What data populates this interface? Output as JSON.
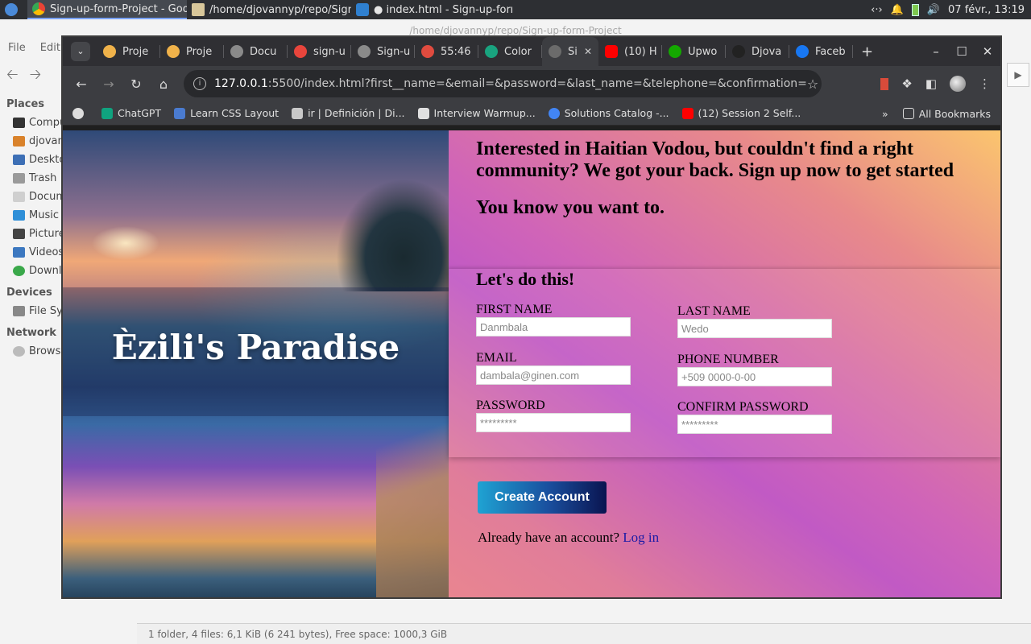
{
  "panel": {
    "tasks": [
      {
        "label": "Sign-up-form-Project - Goog...",
        "active": true
      },
      {
        "label": "/home/djovannyp/repo/Sign...",
        "active": false
      },
      {
        "label": "● index.html - Sign-up-form-...",
        "active": false
      }
    ],
    "clock": "07 févr., 13:19"
  },
  "file_manager": {
    "title": "/home/djovannyp/repo/Sign-up-form-Project",
    "menu": [
      "File",
      "Edit"
    ],
    "places_header": "Places",
    "places": [
      "Compu",
      "djovann",
      "Deskto",
      "Trash",
      "Docum",
      "Music",
      "Picture",
      "Videos",
      "Downlo"
    ],
    "devices_header": "Devices",
    "devices": [
      "File Sys"
    ],
    "network_header": "Network",
    "network": [
      "Browse"
    ],
    "status": "1 folder, 4 files: 6,1 KiB (6 241 bytes), Free space: 1000,3 GiB"
  },
  "browser": {
    "tabs": [
      {
        "title": "Proje",
        "color": "#f0b24a"
      },
      {
        "title": "Proje",
        "color": "#f0b24a"
      },
      {
        "title": "Docu",
        "color": "#8a8a8a"
      },
      {
        "title": "sign-u",
        "color": "#e8453c"
      },
      {
        "title": "Sign-u",
        "color": "#8a8a8a"
      },
      {
        "title": "55:46",
        "color": "#e04b3f"
      },
      {
        "title": "Color",
        "color": "#19a37f"
      },
      {
        "title": "Si",
        "color": "#6b6b6b",
        "active": true
      },
      {
        "title": "(10) H",
        "color": "#ff0000"
      },
      {
        "title": "Upwo",
        "color": "#14a800"
      },
      {
        "title": "Djova",
        "color": "#222222"
      },
      {
        "title": "Faceb",
        "color": "#1877f2"
      }
    ],
    "url_host": "127.0.0.1",
    "url_rest": ":5500/index.html?first__name=&email=&password=&last_name=&telephone=&confirmation=",
    "bookmarks": [
      {
        "label": "ChatGPT",
        "color": "#10a37f"
      },
      {
        "label": "Learn CSS Layout",
        "color": "#4a7bd0"
      },
      {
        "label": "ir | Definición | Di...",
        "color": "#c9c9c9"
      },
      {
        "label": "Interview Warmup...",
        "color": "#e0e0e0"
      },
      {
        "label": "Solutions Catalog -...",
        "color": "#4285f4"
      },
      {
        "label": "(12) Session 2 Self...",
        "color": "#ff0000"
      }
    ],
    "all_bookmarks": "All Bookmarks"
  },
  "page": {
    "brand": "Èzili's Paradise",
    "intro": "Interested in Haitian Vodou, but couldn't find a right community? We got your back. Sign up now to get started",
    "tagline": "You know you want to.",
    "form_title": "Let's do this!",
    "fields": {
      "first_name": {
        "label": "FIRST NAME",
        "placeholder": "Danmbala"
      },
      "last_name": {
        "label": "LAST NAME",
        "placeholder": "Wedo"
      },
      "email": {
        "label": "EMAIL",
        "placeholder": "dambala@ginen.com"
      },
      "phone": {
        "label": "PHONE NUMBER",
        "placeholder": "+509 0000-0-00"
      },
      "password": {
        "label": "PASSWORD",
        "placeholder": "*********"
      },
      "confirm": {
        "label": "CONFIRM PASSWORD",
        "placeholder": "*********"
      }
    },
    "create_button": "Create Account",
    "login_prompt": "Already have an account?",
    "login_link": "Log in"
  }
}
